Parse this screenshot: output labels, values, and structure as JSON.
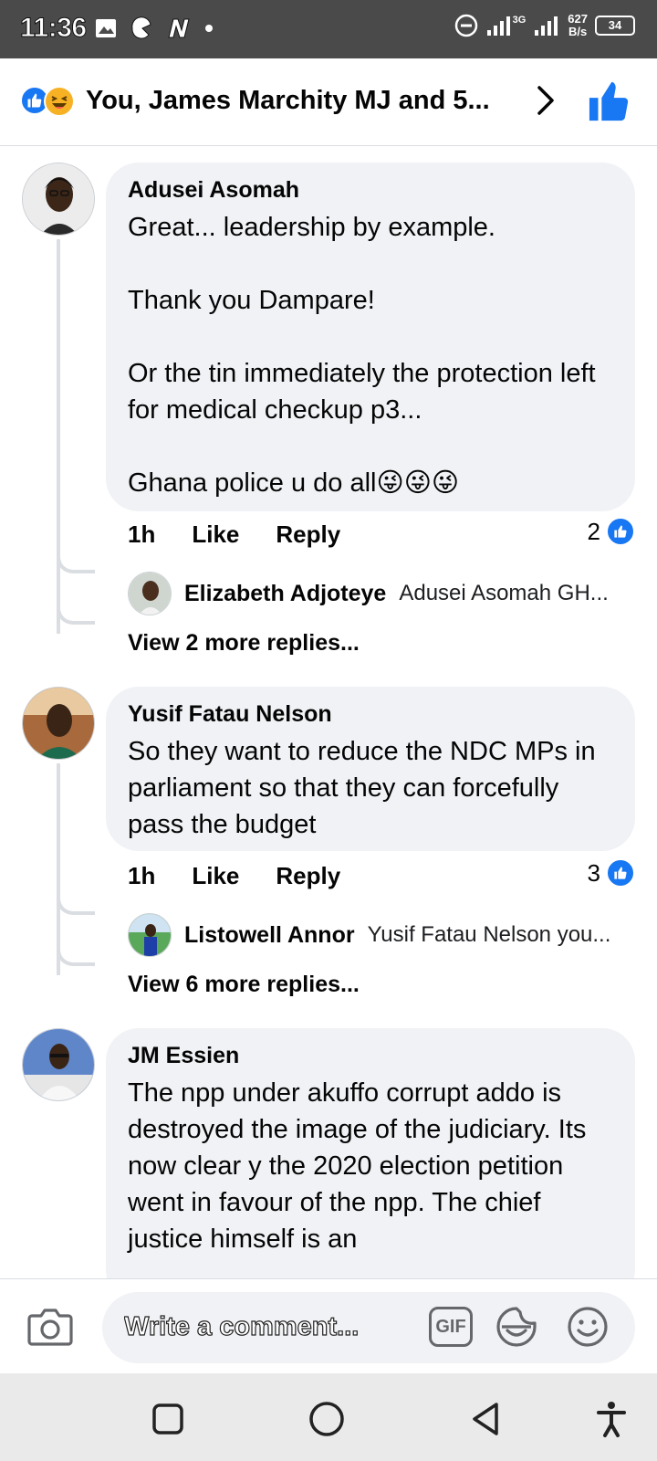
{
  "status_bar": {
    "time": "11:36",
    "network_speed_value": "627",
    "network_speed_unit": "B/s",
    "battery": "34",
    "signal_label": "3G"
  },
  "header": {
    "title": "You, James Marchity MJ and 5...",
    "reactions": [
      "like-icon",
      "haha-icon"
    ]
  },
  "comments": [
    {
      "author": "Adusei Asomah",
      "text": "Great... leadership by example.\n\nThank you Dampare!\n\nOr the tin immediately the protection left for medical checkup p3...\n\nGhana police u do all😜😜😜",
      "time": "1h",
      "like_label": "Like",
      "reply_label": "Reply",
      "reaction_count": "2",
      "reply_preview": {
        "author": "Elizabeth Adjoteye",
        "text": "Adusei Asomah GH..."
      },
      "more_replies": "View 2 more replies..."
    },
    {
      "author": "Yusif Fatau Nelson",
      "text": "So they want to reduce the NDC MPs in parliament so that they can forcefully pass the budget",
      "time": "1h",
      "like_label": "Like",
      "reply_label": "Reply",
      "reaction_count": "3",
      "reply_preview": {
        "author": "Listowell Annor",
        "text": "Yusif Fatau Nelson you..."
      },
      "more_replies": "View 6 more replies..."
    },
    {
      "author": "JM Essien",
      "text": "The npp under akuffo corrupt addo is destroyed the image of the judiciary. Its now clear y the 2020 election petition went in favour of the npp. The chief justice himself is an"
    }
  ],
  "composer": {
    "placeholder": "Write a comment...",
    "gif_label": "GIF"
  },
  "colors": {
    "accent": "#1877f2",
    "bubble": "#f0f2f5",
    "status_bar": "#4a4a4a"
  }
}
